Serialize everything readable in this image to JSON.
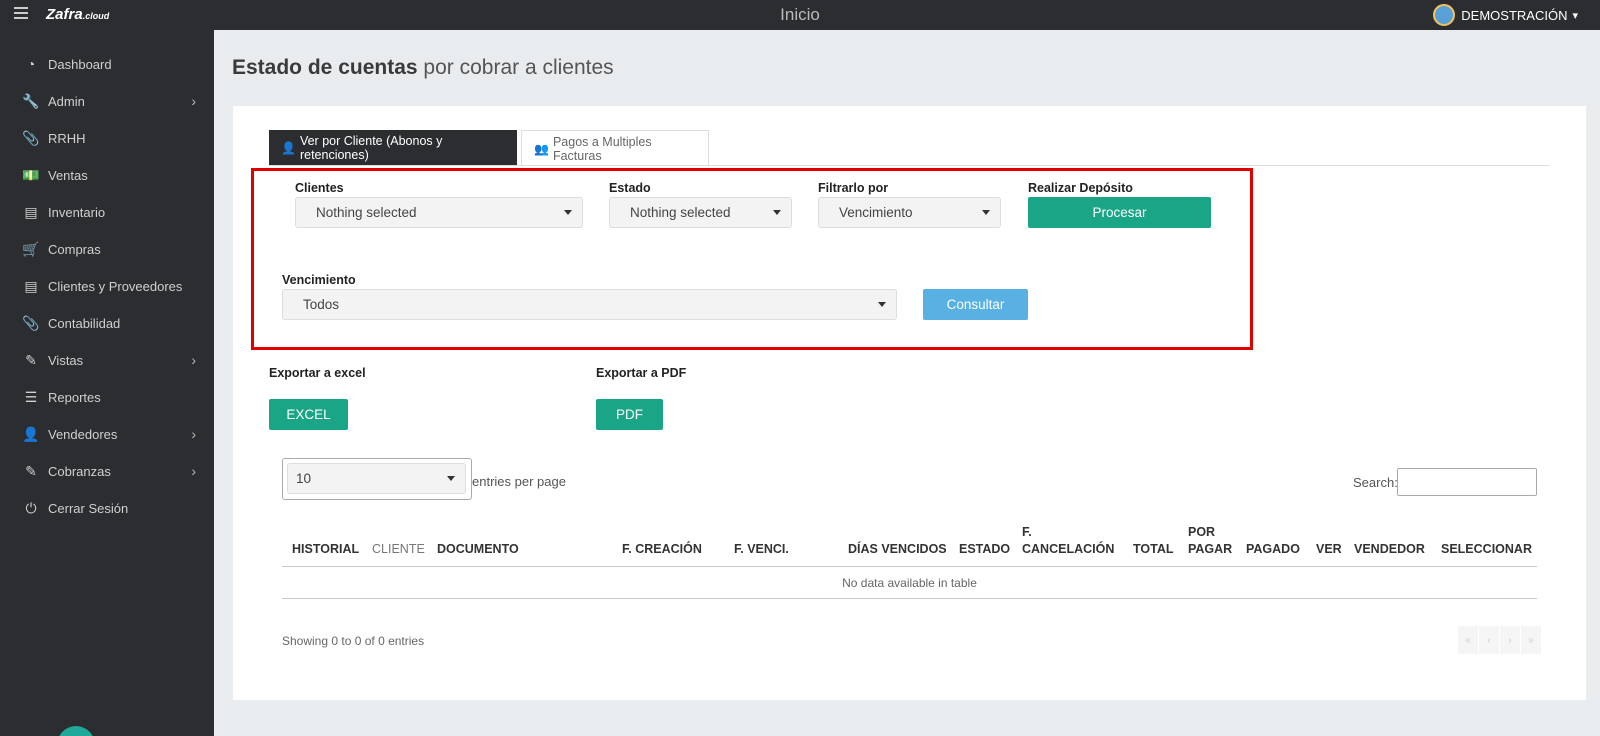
{
  "app": {
    "logo": "Zafra",
    "logo_suffix": ".cloud",
    "page_header": "Inicio",
    "user_name": "DEMOSTRACIÓN"
  },
  "sidebar": {
    "items": [
      {
        "label": "Dashboard",
        "icon": "dashboard-icon",
        "glyph": "◔",
        "has_submenu": false
      },
      {
        "label": "Admin",
        "icon": "wrench-icon",
        "glyph": "🔧",
        "has_submenu": true
      },
      {
        "label": "RRHH",
        "icon": "paperclip-icon",
        "glyph": "📎",
        "has_submenu": false
      },
      {
        "label": "Ventas",
        "icon": "money-icon",
        "glyph": "💵",
        "has_submenu": false
      },
      {
        "label": "Inventario",
        "icon": "book-icon",
        "glyph": "▤",
        "has_submenu": false
      },
      {
        "label": "Compras",
        "icon": "cart-icon",
        "glyph": "🛒",
        "has_submenu": false
      },
      {
        "label": "Clientes y Proveedores",
        "icon": "book-icon",
        "glyph": "▤",
        "has_submenu": false
      },
      {
        "label": "Contabilidad",
        "icon": "paperclip-icon",
        "glyph": "📎",
        "has_submenu": false
      },
      {
        "label": "Vistas",
        "icon": "edit-icon",
        "glyph": "✎",
        "has_submenu": true
      },
      {
        "label": "Reportes",
        "icon": "list-icon",
        "glyph": "☰",
        "has_submenu": false
      },
      {
        "label": "Vendedores",
        "icon": "user-icon",
        "glyph": "👤",
        "has_submenu": true
      },
      {
        "label": "Cobranzas",
        "icon": "edit-icon",
        "glyph": "✎",
        "has_submenu": true
      },
      {
        "label": "Cerrar Sesión",
        "icon": "power-icon",
        "glyph": "⏻",
        "has_submenu": false
      }
    ]
  },
  "page": {
    "title_bold": "Estado de cuentas",
    "title_rest": "por cobrar a clientes"
  },
  "tabs": [
    {
      "label": "Ver por Cliente (Abonos y retenciones)",
      "icon": "user-icon",
      "active": true
    },
    {
      "label": "Pagos a Multiples Facturas",
      "icon": "users-icon",
      "active": false
    }
  ],
  "filters": {
    "clientes_label": "Clientes",
    "clientes_value": "Nothing selected",
    "estado_label": "Estado",
    "estado_value": "Nothing selected",
    "filtrar_label": "Filtrarlo por",
    "filtrar_value": "Vencimiento",
    "deposito_label": "Realizar Depósito",
    "procesar_button": "Procesar",
    "vencimiento_label": "Vencimiento",
    "vencimiento_value": "Todos",
    "consultar_button": "Consultar"
  },
  "export": {
    "excel_label": "Exportar a excel",
    "excel_button": "EXCEL",
    "pdf_label": "Exportar a PDF",
    "pdf_button": "PDF"
  },
  "table": {
    "page_size": "10",
    "entries_text": "entries per page",
    "search_label": "Search:",
    "columns": [
      {
        "line1": "",
        "line2": "HISTORIAL"
      },
      {
        "line1": "",
        "line2": "CLIENTE"
      },
      {
        "line1": "",
        "line2": "DOCUMENTO"
      },
      {
        "line1": "",
        "line2": "F. CREACIÓN"
      },
      {
        "line1": "",
        "line2": "F. VENCI."
      },
      {
        "line1": "",
        "line2": "DÍAS VENCIDOS"
      },
      {
        "line1": "",
        "line2": "ESTADO"
      },
      {
        "line1": "F.",
        "line2": "CANCELACIÓN"
      },
      {
        "line1": "",
        "line2": "TOTAL"
      },
      {
        "line1": "POR",
        "line2": "PAGAR"
      },
      {
        "line1": "",
        "line2": "PAGADO"
      },
      {
        "line1": "",
        "line2": "VER"
      },
      {
        "line1": "",
        "line2": "VENDEDOR"
      },
      {
        "line1": "",
        "line2": "SELECCIONAR"
      }
    ],
    "empty_message": "No data available in table",
    "showing": "Showing 0 to 0 of 0 entries",
    "pager": [
      "«",
      "‹",
      "›",
      "»"
    ]
  }
}
